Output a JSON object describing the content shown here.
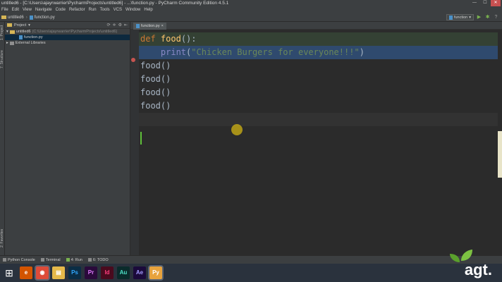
{
  "window": {
    "title": "untitled6 - [C:\\Users\\ajayrwarrier\\PycharmProjects\\untitled6] - ...\\function.py - PyCharm Community Edition 4.5.1",
    "minimize": "—",
    "maximize": "☐",
    "close": "✕"
  },
  "menu": [
    "File",
    "Edit",
    "View",
    "Navigate",
    "Code",
    "Refactor",
    "Run",
    "Tools",
    "VCS",
    "Window",
    "Help"
  ],
  "navbar": {
    "project": "untitled6",
    "file": "function.py",
    "run_config": "function"
  },
  "project_panel": {
    "header": "Project",
    "root_name": "untitled6",
    "root_path": "(C:\\Users\\ajayrwarrier\\PycharmProjects\\untitled6)",
    "file": "function.py",
    "libraries": "External Libraries"
  },
  "side_tabs": {
    "project": "1: Project",
    "structure": "7: Structure",
    "favorites": "2: Favorites"
  },
  "editor": {
    "tab_label": "function.py",
    "lines": [
      {
        "kw": "def",
        "name": "food",
        "rest": "():"
      },
      {
        "indent": "    ",
        "builtin": "print",
        "open": "(",
        "str": "\"Chicken Burgers for everyone!!!\"",
        "close": ")"
      },
      {
        "text": "food()"
      },
      {
        "text": "food()"
      },
      {
        "text": "food()"
      },
      {
        "text": "food()"
      }
    ]
  },
  "bottom_tabs": [
    "Python Console",
    "Terminal",
    "4: Run",
    "6: TODO"
  ],
  "taskbar": {
    "apps": [
      {
        "label": "⊞",
        "name": "windows-start-icon"
      },
      {
        "label": "e",
        "name": "firefox-icon"
      },
      {
        "label": "◉",
        "name": "chrome-icon"
      },
      {
        "label": "▤",
        "name": "file-explorer-icon"
      },
      {
        "label": "Ps",
        "name": "photoshop-icon"
      },
      {
        "label": "Pr",
        "name": "premiere-icon"
      },
      {
        "label": "Id",
        "name": "indesign-icon"
      },
      {
        "label": "Au",
        "name": "audition-icon"
      },
      {
        "label": "Ae",
        "name": "after-effects-icon"
      },
      {
        "label": "Py",
        "name": "pycharm-icon"
      }
    ]
  },
  "watermark": "agt.",
  "colors": {
    "keyword": "#cc7832",
    "function_name": "#ffc66d",
    "builtin": "#8888c6",
    "string": "#6a8759",
    "caret": "#5fbf3a"
  }
}
